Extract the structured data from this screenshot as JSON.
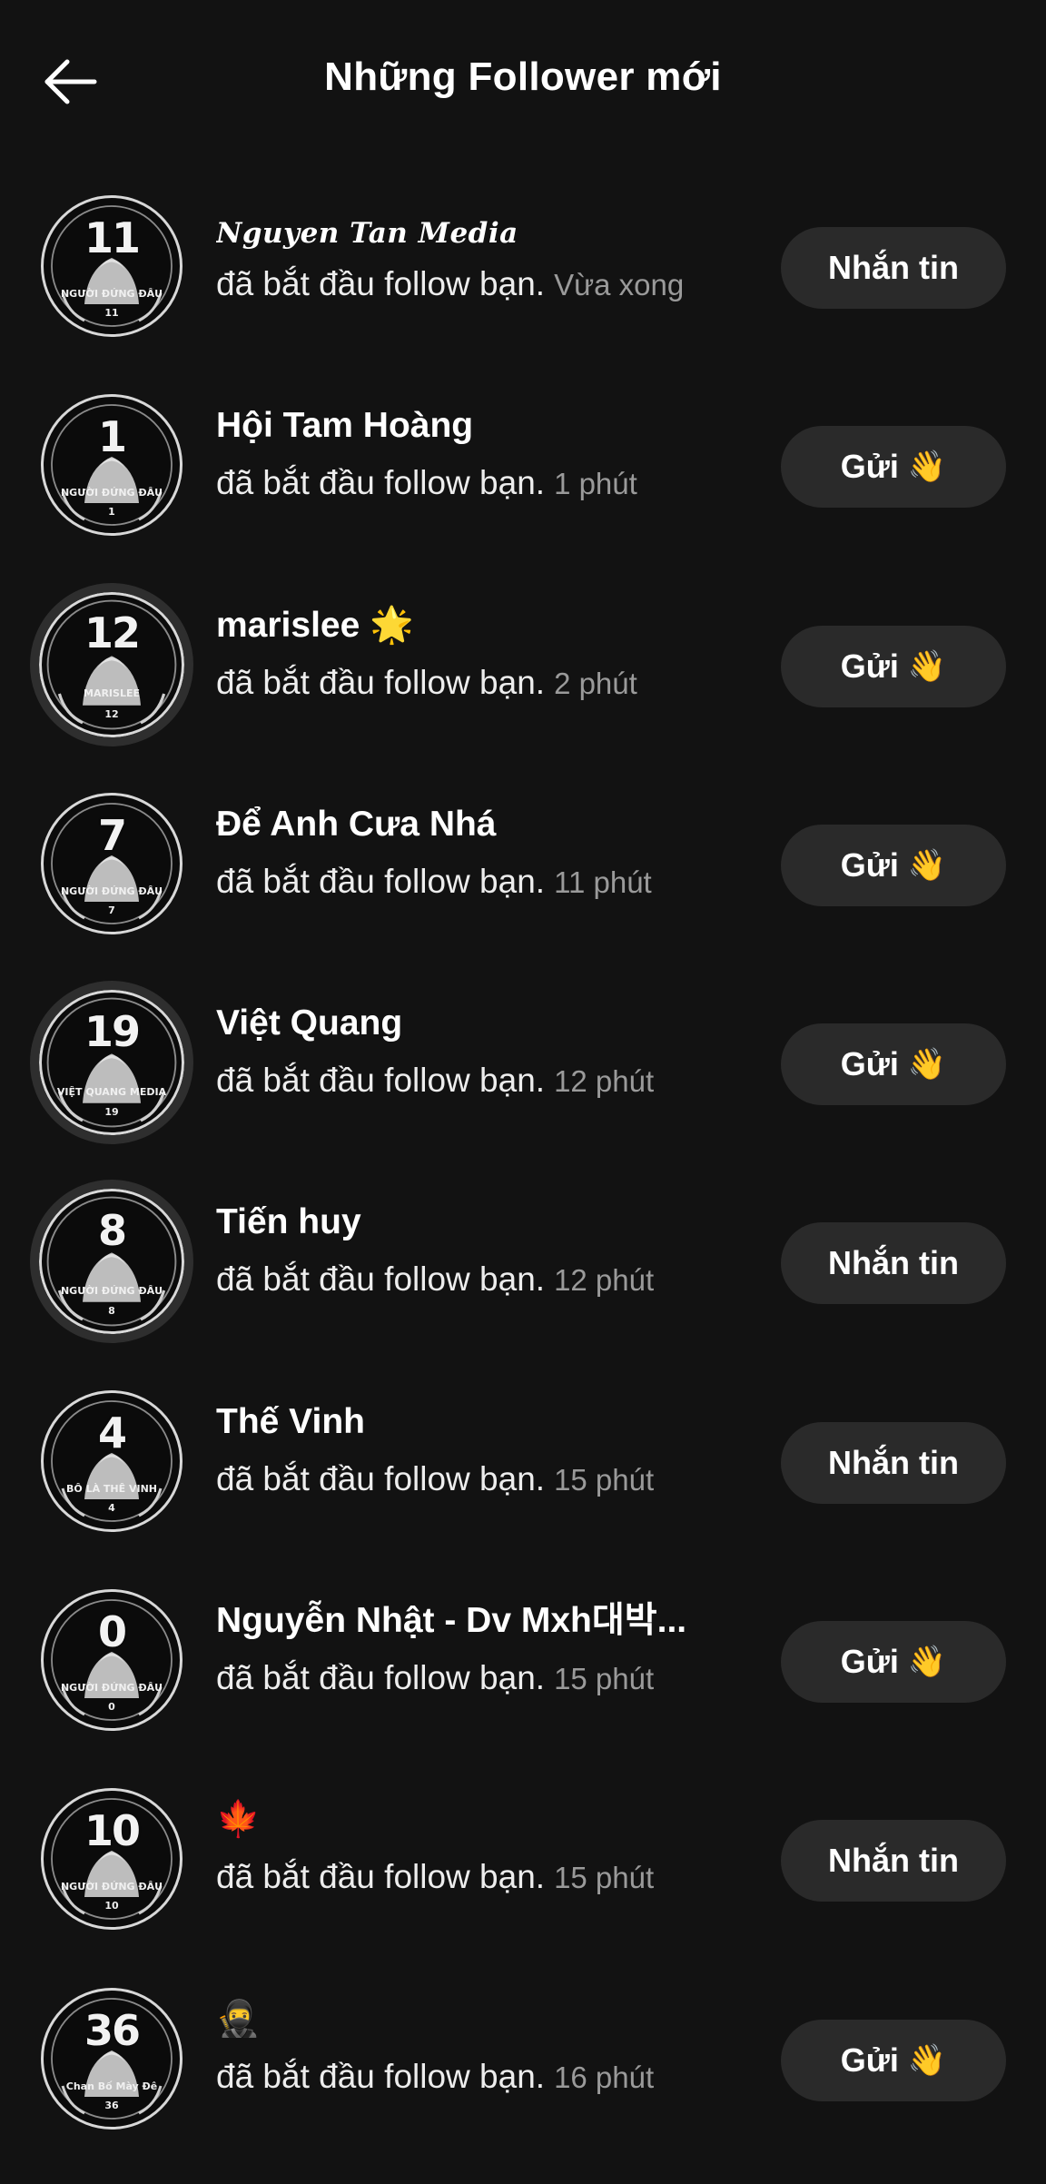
{
  "header": {
    "title": "Những Follower mới"
  },
  "followers": [
    {
      "name": "Nguyen Tan Media",
      "action": "đã bắt đầu follow bạn.",
      "time": "Vừa xong",
      "button": "Nhắn tin",
      "wave": "",
      "avatar_num": "11",
      "avatar_caption": "NGƯỜI ĐỨNG ĐẦU",
      "avatar_sub": "11",
      "ringed": false,
      "script": true
    },
    {
      "name": "Hội Tam Hoàng",
      "action": "đã bắt đầu follow bạn.",
      "time": "1 phút",
      "button": "Gửi",
      "wave": "👋",
      "avatar_num": "1",
      "avatar_caption": "NGƯỜI ĐỨNG ĐẦU",
      "avatar_sub": "1",
      "ringed": false,
      "script": false
    },
    {
      "name": "marislee 🌟",
      "action": "đã bắt đầu follow bạn.",
      "time": "2 phút",
      "button": "Gửi",
      "wave": "👋",
      "avatar_num": "12",
      "avatar_caption": "MARISLEE",
      "avatar_sub": "12",
      "ringed": true,
      "script": false
    },
    {
      "name": "Để Anh Cưa Nhá",
      "action": "đã bắt đầu follow bạn.",
      "time": "11 phút",
      "button": "Gửi",
      "wave": "👋",
      "avatar_num": "7",
      "avatar_caption": "NGƯỜI ĐỨNG ĐẦU",
      "avatar_sub": "7",
      "ringed": false,
      "script": false
    },
    {
      "name": "Việt Quang",
      "action": "đã bắt đầu follow bạn.",
      "time": "12 phút",
      "button": "Gửi",
      "wave": "👋",
      "avatar_num": "19",
      "avatar_caption": "VIỆT QUANG MEDIA",
      "avatar_sub": "19",
      "ringed": true,
      "script": false
    },
    {
      "name": "Tiến huy",
      "action": "đã bắt đầu follow bạn.",
      "time": "12 phút",
      "button": "Nhắn tin",
      "wave": "",
      "avatar_num": "8",
      "avatar_caption": "NGƯỜI ĐỨNG ĐẦU",
      "avatar_sub": "8",
      "ringed": true,
      "script": false
    },
    {
      "name": "Thế Vinh",
      "action": "đã bắt đầu follow bạn.",
      "time": "15 phút",
      "button": "Nhắn tin",
      "wave": "",
      "avatar_num": "4",
      "avatar_caption": "BỐ LÀ THẾ VINH",
      "avatar_sub": "4",
      "ringed": false,
      "script": false
    },
    {
      "name": "Nguyễn Nhật - Dv Mxh대박...",
      "action": "đã bắt đầu follow bạn.",
      "time": "15 phút",
      "button": "Gửi",
      "wave": "👋",
      "avatar_num": "0",
      "avatar_caption": "NGƯỜI ĐỨNG ĐẦU",
      "avatar_sub": "0",
      "ringed": false,
      "script": false
    },
    {
      "name": "🍁",
      "action": "đã bắt đầu follow bạn.",
      "time": "15 phút",
      "button": "Nhắn tin",
      "wave": "",
      "avatar_num": "10",
      "avatar_caption": "NGƯỜI ĐỨNG ĐẦU",
      "avatar_sub": "10",
      "ringed": false,
      "script": false
    },
    {
      "name": "🥷",
      "action": "đã bắt đầu follow bạn.",
      "time": "16 phút",
      "button": "Gửi",
      "wave": "👋",
      "avatar_num": "36",
      "avatar_caption": "Chan Bố Mày Đê",
      "avatar_sub": "36",
      "ringed": false,
      "script": false
    }
  ],
  "icons": {
    "back": "arrow-left-icon",
    "wave": "waving-hand-icon"
  },
  "colors": {
    "background": "#121212",
    "button_bg": "#2a2a2a",
    "text_primary": "#ffffff",
    "text_secondary": "#9a9a9a"
  }
}
